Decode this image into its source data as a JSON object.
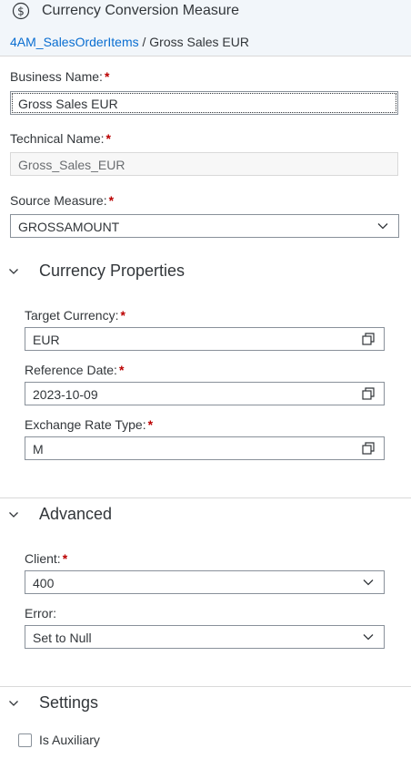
{
  "header": {
    "title": "Currency Conversion Measure",
    "breadcrumb": {
      "parent": "4AM_SalesOrderItems",
      "separator": "/",
      "current": "Gross Sales EUR"
    }
  },
  "form": {
    "business_name": {
      "label": "Business Name:",
      "required": "*",
      "value": "Gross Sales EUR"
    },
    "technical_name": {
      "label": "Technical Name:",
      "required": "*",
      "value": "Gross_Sales_EUR"
    },
    "source_measure": {
      "label": "Source Measure:",
      "required": "*",
      "value": "GROSSAMOUNT"
    }
  },
  "currency_properties": {
    "title": "Currency Properties",
    "target_currency": {
      "label": "Target Currency:",
      "required": "*",
      "value": "EUR"
    },
    "reference_date": {
      "label": "Reference Date:",
      "required": "*",
      "value": "2023-10-09"
    },
    "exchange_rate_type": {
      "label": "Exchange Rate Type:",
      "required": "*",
      "value": "M"
    }
  },
  "advanced": {
    "title": "Advanced",
    "client": {
      "label": "Client:",
      "required": "*",
      "value": "400"
    },
    "error": {
      "label": "Error:",
      "value": "Set to Null"
    }
  },
  "settings": {
    "title": "Settings",
    "is_auxiliary": {
      "label": "Is Auxiliary",
      "checked": false
    }
  },
  "colors": {
    "link": "#0a6ed1",
    "required": "#bb0000",
    "header_bg": "#f2f6fa",
    "border": "#89919a"
  }
}
